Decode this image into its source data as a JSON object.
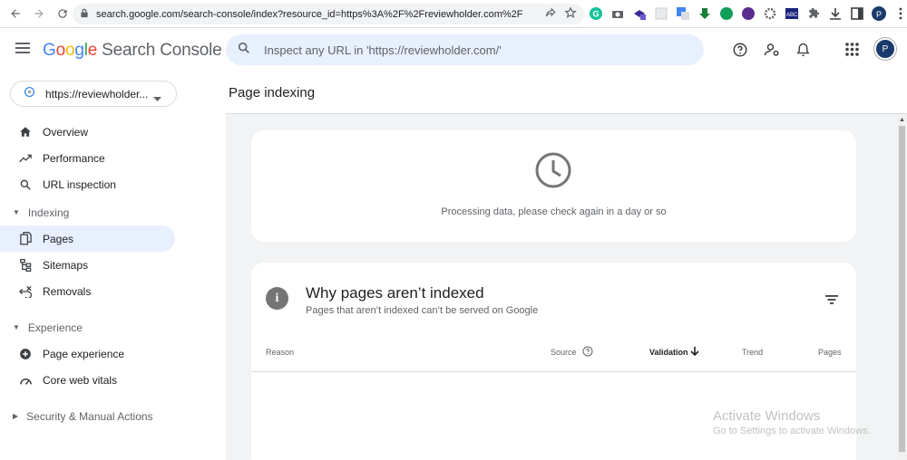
{
  "browser": {
    "url": "search.google.com/search-console/index?resource_id=https%3A%2F%2Freviewholder.com%2F"
  },
  "header": {
    "logo_letters": [
      "G",
      "o",
      "o",
      "g",
      "l",
      "e"
    ],
    "product": "Search Console",
    "search_placeholder": "Inspect any URL in 'https://reviewholder.com/'",
    "avatar_initial": "P"
  },
  "property": {
    "name": "https://reviewholder..."
  },
  "sidebar": {
    "items": [
      {
        "label": "Overview",
        "icon": "home-icon"
      },
      {
        "label": "Performance",
        "icon": "trending-up-icon"
      },
      {
        "label": "URL inspection",
        "icon": "search-icon"
      }
    ],
    "indexing": {
      "label": "Indexing",
      "items": [
        {
          "label": "Pages",
          "icon": "pages-icon",
          "active": true
        },
        {
          "label": "Sitemaps",
          "icon": "sitemap-icon"
        },
        {
          "label": "Removals",
          "icon": "removals-icon"
        }
      ]
    },
    "experience": {
      "label": "Experience",
      "items": [
        {
          "label": "Page experience",
          "icon": "page-experience-icon"
        },
        {
          "label": "Core web vitals",
          "icon": "gauge-icon"
        }
      ]
    },
    "security": {
      "label": "Security & Manual Actions"
    }
  },
  "main": {
    "page_title": "Page indexing",
    "processing_message": "Processing data, please check again in a day or so",
    "why": {
      "title": "Why pages aren’t indexed",
      "subtitle": "Pages that aren’t indexed can’t be served on Google"
    },
    "table_headers": {
      "reason": "Reason",
      "source": "Source",
      "validation": "Validation",
      "trend": "Trend",
      "pages": "Pages"
    }
  },
  "watermark": {
    "line1": "Activate Windows",
    "line2": "Go to Settings to activate Windows."
  },
  "colors": {
    "accent_bg": "#e8f0fe",
    "page_bg": "#f1f3f4"
  }
}
